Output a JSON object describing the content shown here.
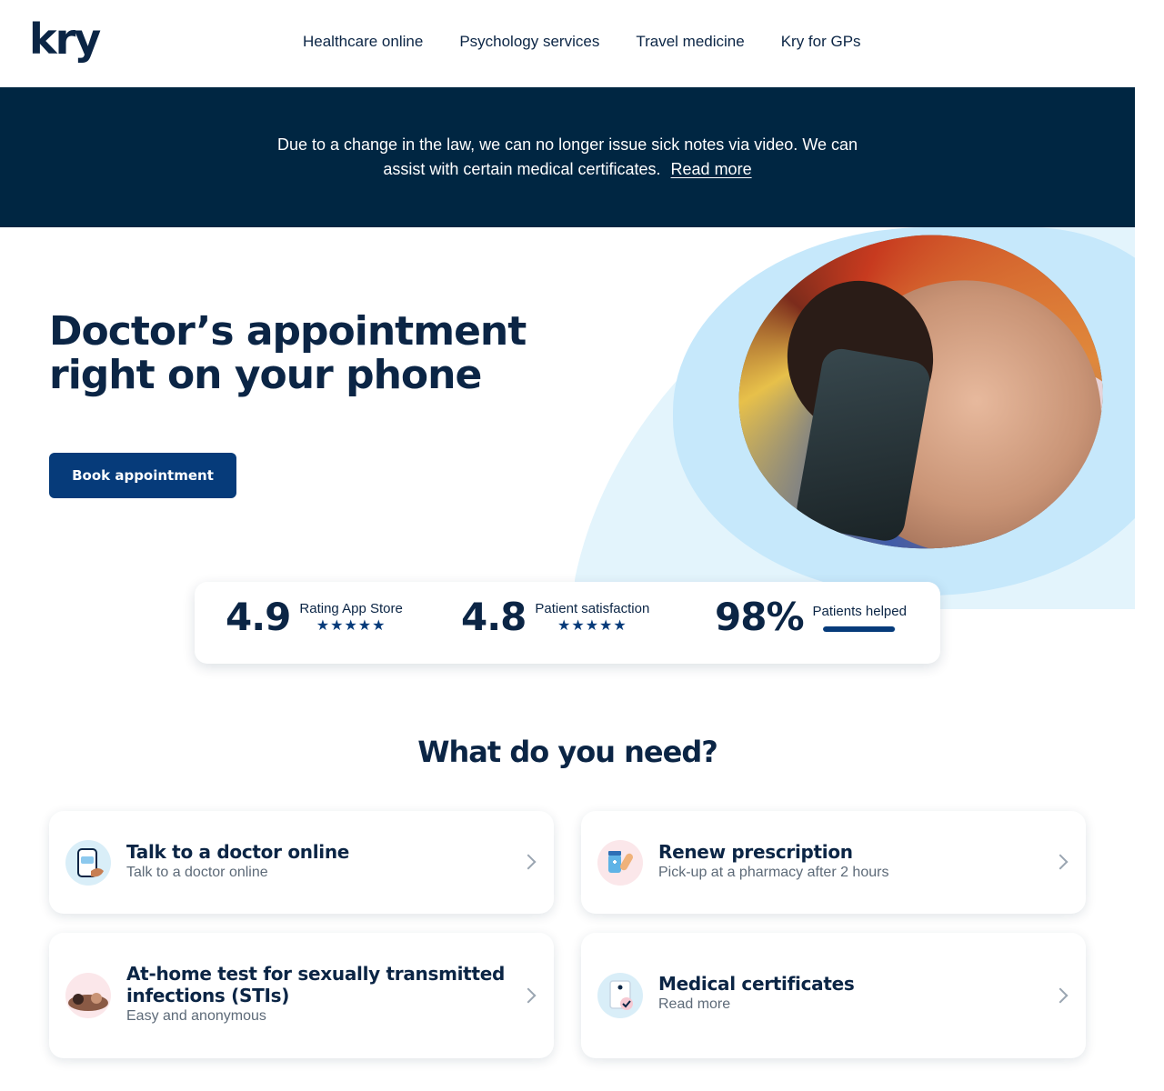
{
  "header": {
    "logo": "kry",
    "nav": [
      {
        "label": "Healthcare online"
      },
      {
        "label": "Psychology services"
      },
      {
        "label": "Travel medicine"
      },
      {
        "label": "Kry for GPs"
      }
    ]
  },
  "banner": {
    "text": "Due to a change in the law, we can no longer issue sick notes via video. We can assist with certain medical certificates.",
    "link_label": "Read more"
  },
  "hero": {
    "title": "Doctor’s appointment right on your phone",
    "cta_label": "Book appointment"
  },
  "stats": [
    {
      "value": "4.9",
      "label": "Rating App Store",
      "stars": "★★★★★",
      "rating": 5
    },
    {
      "value": "4.8",
      "label": "Patient satisfaction",
      "stars": "★★★★★",
      "rating": 5
    },
    {
      "value": "98%",
      "label": "Patients helped",
      "progress": 0.98
    }
  ],
  "needs": {
    "title": "What do you need?",
    "cards": [
      {
        "title": "Talk to a doctor online",
        "subtitle": "Talk to a doctor online",
        "icon": "phone-doctor-icon"
      },
      {
        "title": "Renew prescription",
        "subtitle": "Pick-up at a pharmacy after 2 hours",
        "icon": "medicine-icon"
      },
      {
        "title": "At-home test for sexually transmitted infections (STIs)",
        "subtitle": "Easy and anonymous",
        "icon": "couple-icon"
      },
      {
        "title": "Medical certificates",
        "subtitle": "Read more",
        "icon": "certificate-icon"
      }
    ]
  },
  "colors": {
    "navy": "#0b2545",
    "banner": "#002642",
    "button": "#063b7a",
    "hero_light_blue": "#e3f4fc",
    "hero_blue": "#c6e8fb"
  }
}
